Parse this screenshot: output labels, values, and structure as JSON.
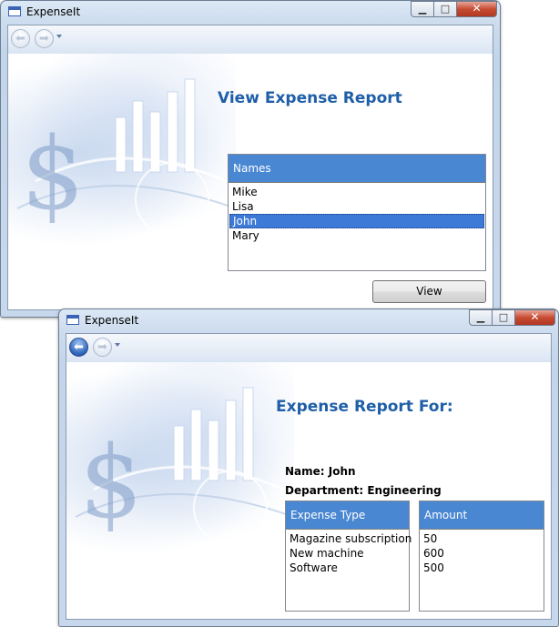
{
  "window1": {
    "title": "ExpenseIt",
    "heading": "View Expense Report",
    "names_header": "Names",
    "names": [
      "Mike",
      "Lisa",
      "John",
      "Mary"
    ],
    "selected_name": "John",
    "view_button": "View"
  },
  "window2": {
    "title": "ExpenseIt",
    "heading": "Expense Report For:",
    "name_label": "Name: John",
    "department_label": "Department: Engineering",
    "expense_type_header": "Expense Type",
    "amount_header": "Amount",
    "expense_types": [
      "Magazine subscription",
      "New machine",
      "Software"
    ],
    "amounts": [
      "50",
      "600",
      "500"
    ]
  },
  "icons": {
    "back": "back-arrow-icon",
    "forward": "forward-arrow-icon",
    "minimize": "minimize-icon",
    "maximize": "maximize-icon",
    "close": "close-icon"
  },
  "colors": {
    "header_blue": "#4a87d3",
    "heading_blue": "#1f5fa8",
    "selection_blue": "#3d7ad8"
  }
}
